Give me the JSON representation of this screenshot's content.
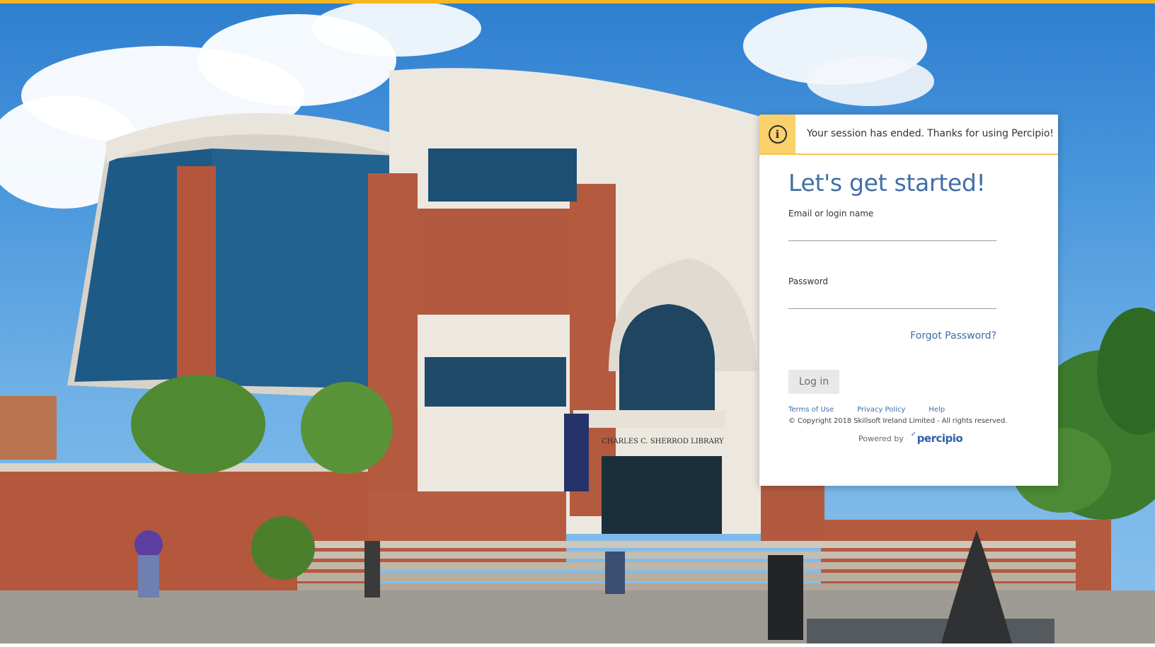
{
  "colors": {
    "accent_bar": "#f5b621",
    "banner_icon_bg": "#fbd16b",
    "heading": "#3f6fa8",
    "link": "#3f6fa8",
    "brand": "#2f5fa8"
  },
  "banner": {
    "icon": "info-icon",
    "message": "Your session has ended. Thanks for using Percipio!"
  },
  "login": {
    "heading": "Let's get started!",
    "email_label": "Email or login name",
    "email_value": "",
    "password_label": "Password",
    "password_value": "",
    "forgot_password": "Forgot Password?",
    "login_button": "Log in"
  },
  "footer": {
    "links": [
      "Terms of Use",
      "Privacy Policy",
      "Help"
    ],
    "copyright": "© Copyright 2018 Skillsoft Ireland Limited - All rights reserved.",
    "powered_by": "Powered by",
    "brand_logo": "percipio"
  },
  "background": {
    "sign_text": "CHARLES C. SHERROD LIBRARY"
  }
}
